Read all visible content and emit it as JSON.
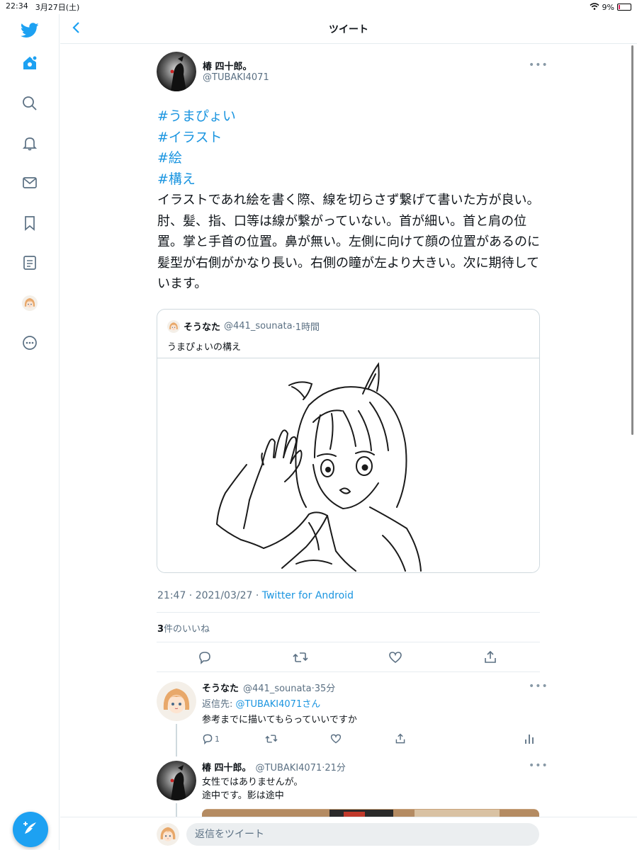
{
  "status_bar": {
    "time": "22:34",
    "date": "3月27日(土)",
    "battery": "9%"
  },
  "header": {
    "title": "ツイート"
  },
  "sidebar": {
    "items": [
      "twitter-logo",
      "home",
      "explore",
      "notifications",
      "messages",
      "bookmarks",
      "lists",
      "profile",
      "more"
    ],
    "compose_icon": "compose-tweet-icon"
  },
  "tweet": {
    "author_name": "椿 四十郎。",
    "author_handle": "@TUBAKI4071",
    "hashtags": [
      "#うまぴょい",
      "#イラスト",
      "#絵",
      "#構え"
    ],
    "text": "イラストであれ絵を書く際、線を切らさず繋げて書いた方が良い。肘、髪、指、口等は線が繋がっていない。首が細い。首と肩の位置。掌と手首の位置。鼻が無い。左側に向けて顔の位置があるのに髪型が右側がかなり長い。右側の瞳が左より大きい。次に期待しています。",
    "quote": {
      "name": "そうなた",
      "handle": "@441_sounata",
      "time": "·1時間",
      "text": "うまぴょいの構え"
    },
    "timestamp": "21:47 · 2021/03/27 · ",
    "source": "Twitter for Android",
    "likes_count": "3",
    "likes_label": "件のいいね"
  },
  "replies": [
    {
      "name": "そうなた",
      "handle": "@441_sounata",
      "time": "·35分",
      "reply_to_label": "返信先: ",
      "reply_to": "@TUBAKI4071さん",
      "text": "参考までに描いてもらっていいですか",
      "reply_count": "1"
    },
    {
      "name": "椿 四十郎。",
      "handle": "@TUBAKI4071",
      "time": "·21分",
      "text_line1": "女性ではありませんが。",
      "text_line2": "途中です。影は途中"
    }
  ],
  "reply_bar": {
    "placeholder": "返信をツイート"
  },
  "colors": {
    "accent": "#1da1f2",
    "link": "#1b95e0",
    "secondary_text": "#5b7083",
    "border": "#e6ecf0"
  }
}
